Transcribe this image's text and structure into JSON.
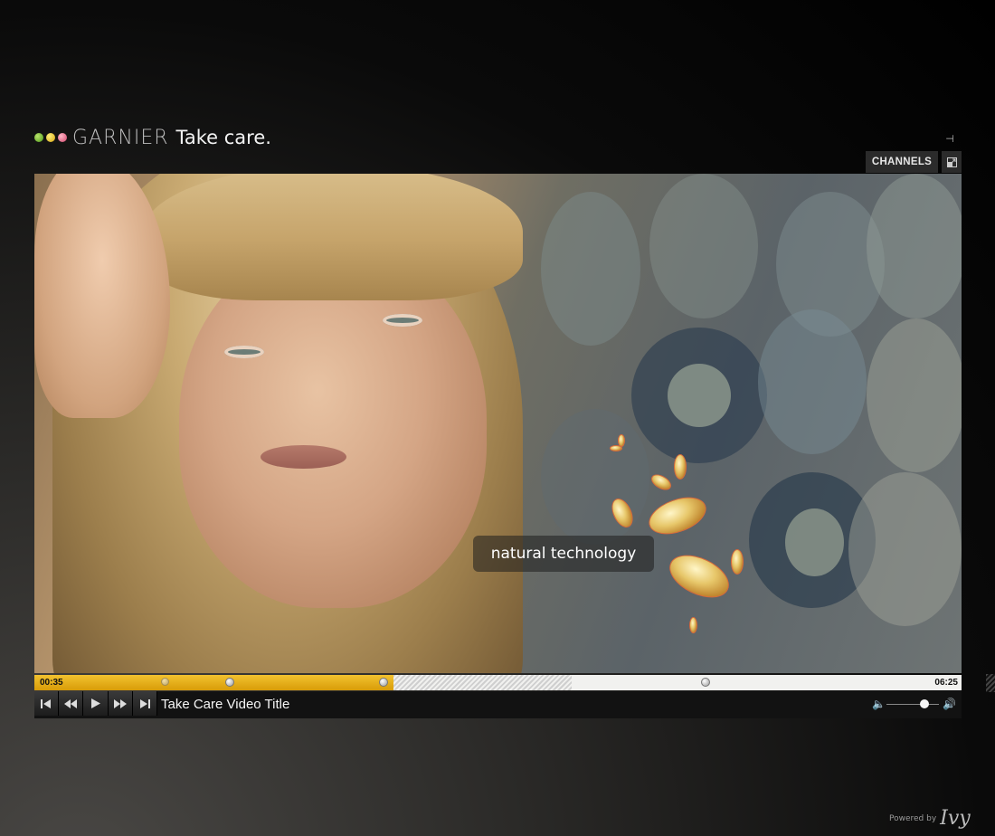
{
  "header": {
    "brand": "GARNIER",
    "tagline": "Take care.",
    "logo_dots": [
      "#4f9a1a",
      "#d4a410",
      "#d1456a"
    ]
  },
  "toolbar": {
    "channels_label": "CHANNELS",
    "pin_icon": "pin-icon",
    "expand_icon": "expand-icon"
  },
  "video": {
    "caption": "natural technology"
  },
  "timeline": {
    "current_time": "00:35",
    "total_time": "06:25",
    "played_fraction": 0.387,
    "buffered_fraction": 0.58,
    "played_color": "#d89c08"
  },
  "controls": {
    "buttons": [
      "skip-back-icon",
      "rewind-icon",
      "play-icon",
      "fast-forward-icon",
      "skip-forward-icon"
    ],
    "title": "Take Care Video Title",
    "volume_fraction": 0.72
  },
  "footer": {
    "powered_by": "Powered by",
    "vendor": "Ivy"
  }
}
